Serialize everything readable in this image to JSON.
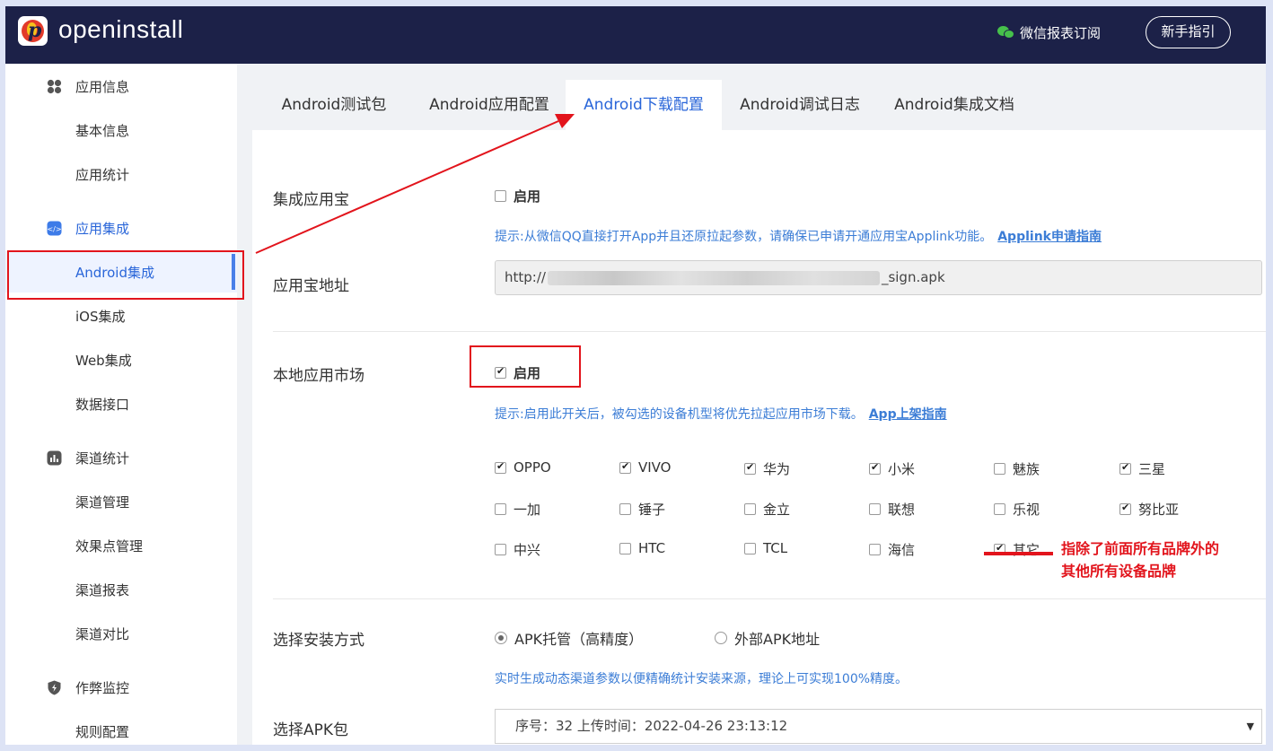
{
  "header": {
    "brand": "openinstall",
    "wechat_label": "微信报表订阅",
    "guide_button": "新手指引"
  },
  "sidebar": {
    "items": [
      {
        "label": "应用信息",
        "type": "group"
      },
      {
        "label": "基本信息",
        "type": "sub"
      },
      {
        "label": "应用统计",
        "type": "sub"
      },
      {
        "label": "应用集成",
        "type": "group"
      },
      {
        "label": "Android集成",
        "type": "sub"
      },
      {
        "label": "iOS集成",
        "type": "sub"
      },
      {
        "label": "Web集成",
        "type": "sub"
      },
      {
        "label": "数据接口",
        "type": "sub"
      },
      {
        "label": "渠道统计",
        "type": "group"
      },
      {
        "label": "渠道管理",
        "type": "sub"
      },
      {
        "label": "效果点管理",
        "type": "sub"
      },
      {
        "label": "渠道报表",
        "type": "sub"
      },
      {
        "label": "渠道对比",
        "type": "sub"
      },
      {
        "label": "作弊监控",
        "type": "group"
      },
      {
        "label": "规则配置",
        "type": "sub"
      }
    ]
  },
  "tabs": [
    "Android测试包",
    "Android应用配置",
    "Android下载配置",
    "Android调试日志",
    "Android集成文档"
  ],
  "form": {
    "yyb": {
      "label": "集成应用宝",
      "enable_label": "启用",
      "tip": "提示:从微信QQ直接打开App并且还原拉起参数，请确保已申请开通应用宝Applink功能。",
      "tip_link": "Applink申请指南"
    },
    "yyb_url": {
      "label": "应用宝地址",
      "prefix": "http://",
      "suffix": "_sign.apk"
    },
    "market": {
      "label": "本地应用市场",
      "enable_label": "启用",
      "tip": "提示:启用此开关后，被勾选的设备机型将优先拉起应用市场下载。",
      "tip_link": "App上架指南",
      "brands": [
        {
          "name": "OPPO",
          "checked": true
        },
        {
          "name": "VIVO",
          "checked": true
        },
        {
          "name": "华为",
          "checked": true
        },
        {
          "name": "小米",
          "checked": true
        },
        {
          "name": "魅族",
          "checked": false
        },
        {
          "name": "三星",
          "checked": true
        },
        {
          "name": "一加",
          "checked": false
        },
        {
          "name": "锤子",
          "checked": false
        },
        {
          "name": "金立",
          "checked": false
        },
        {
          "name": "联想",
          "checked": false
        },
        {
          "name": "乐视",
          "checked": false
        },
        {
          "name": "努比亚",
          "checked": true
        },
        {
          "name": "中兴",
          "checked": false
        },
        {
          "name": "HTC",
          "checked": false
        },
        {
          "name": "TCL",
          "checked": false
        },
        {
          "name": "海信",
          "checked": false
        },
        {
          "name": "其它",
          "checked": true
        }
      ]
    },
    "install": {
      "label": "选择安装方式",
      "option1": "APK托管（高精度）",
      "option2": "外部APK地址",
      "tip": "实时生成动态渠道参数以便精确统计安装来源，理论上可实现100%精度。"
    },
    "apk": {
      "label": "选择APK包",
      "selected": "序号：32 上传时间：2022-04-26 23:13:12"
    }
  },
  "annotation": {
    "line1": "指除了前面所有品牌外的",
    "line2": "其他所有设备品牌"
  },
  "colors": {
    "header_bg": "#1c2148",
    "accent": "#2a66d9",
    "tip": "#3c7dd6",
    "annotation": "#e2141c"
  }
}
